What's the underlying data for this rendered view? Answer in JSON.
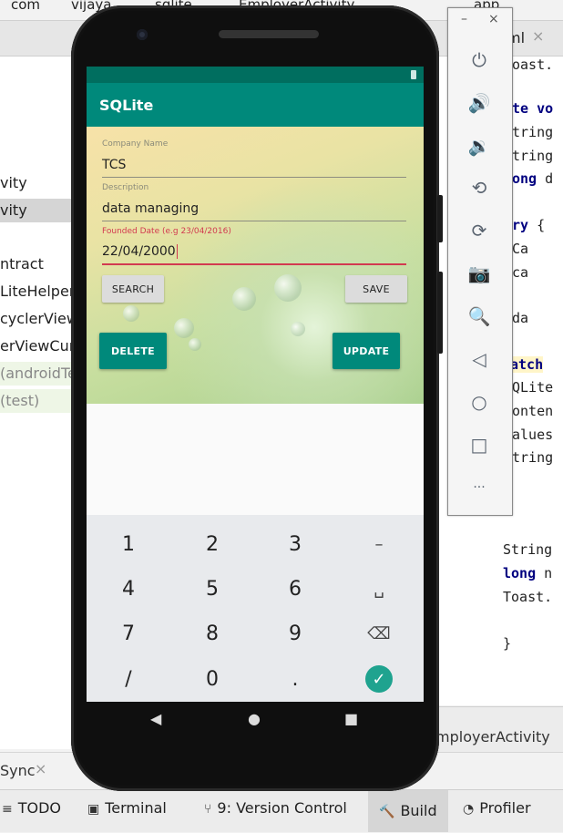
{
  "ide": {
    "breadcrumbs": [
      "com",
      "vijaya",
      "sqlite",
      "EmployerActivity"
    ],
    "run_config": "app",
    "editor_tab": "ml",
    "tree_items": [
      "vity",
      "vity",
      "ntract",
      "LiteHelper",
      "cyclerView",
      "erViewCur",
      "(androidTe",
      "(test)"
    ],
    "code_lines": [
      {
        "pre": "",
        "kw": "",
        "post": "oast."
      },
      {
        "pre": "",
        "kw": "te vo",
        "post": ""
      },
      {
        "pre": "tring",
        "kw": "",
        "post": ""
      },
      {
        "pre": "tring",
        "kw": "",
        "post": ""
      },
      {
        "pre": "",
        "kw": "ong",
        "post": " d"
      },
      {
        "pre": "",
        "kw": "ry",
        "post": " {"
      },
      {
        "pre": "  Ca",
        "kw": "",
        "post": ""
      },
      {
        "pre": "  ca",
        "kw": "",
        "post": ""
      },
      {
        "pre": "  da",
        "kw": "",
        "post": ""
      },
      {
        "pre": "",
        "kw": "atch",
        "post": ""
      },
      {
        "pre": "QLite",
        "kw": "",
        "post": ""
      },
      {
        "pre": "onten",
        "kw": "",
        "post": ""
      },
      {
        "pre": "alues",
        "kw": "",
        "post": ""
      },
      {
        "pre": "tring",
        "kw": "",
        "post": ""
      },
      {
        "pre": "String",
        "kw": "",
        "post": ""
      },
      {
        "pre": "",
        "kw": "long",
        "post": " n"
      },
      {
        "pre": "Toast.",
        "kw": "",
        "post": ""
      },
      {
        "pre": "}",
        "kw": "",
        "post": ""
      }
    ],
    "subtab": "mployerActivity",
    "sync_label": "Sync",
    "bottom_tools": [
      {
        "icon": "≡",
        "label": "TODO"
      },
      {
        "icon": "▣",
        "label": "Terminal"
      },
      {
        "icon": "⑂",
        "label": "9: Version Control"
      },
      {
        "icon": "🔨",
        "label": "Build"
      },
      {
        "icon": "◔",
        "label": "Profiler"
      }
    ]
  },
  "emulator": {
    "minimize": "–",
    "close": "×",
    "buttons": [
      {
        "name": "power-icon",
        "glyph": "⏻"
      },
      {
        "name": "volume-up-icon",
        "glyph": "🔊"
      },
      {
        "name": "volume-down-icon",
        "glyph": "🔉"
      },
      {
        "name": "rotate-left-icon",
        "glyph": "⟲"
      },
      {
        "name": "rotate-right-icon",
        "glyph": "⟳"
      },
      {
        "name": "camera-icon",
        "glyph": "📷"
      },
      {
        "name": "zoom-icon",
        "glyph": "🔍"
      },
      {
        "name": "back-icon",
        "glyph": "◁"
      },
      {
        "name": "home-icon",
        "glyph": "○"
      },
      {
        "name": "overview-icon",
        "glyph": "□"
      },
      {
        "name": "more-icon",
        "glyph": "···"
      }
    ]
  },
  "app": {
    "title": "SQLite",
    "company_label": "Company Name",
    "company_value": "TCS",
    "description_label": "Description",
    "description_value": "data managing",
    "date_label": "Founded Date (e.g 23/04/2016)",
    "date_value": "22/04/2000",
    "search_btn": "SEARCH",
    "save_btn": "SAVE",
    "delete_btn": "DELETE",
    "update_btn": "UPDATE"
  },
  "keyboard": {
    "rows": [
      [
        "1",
        "2",
        "3",
        "–"
      ],
      [
        "4",
        "5",
        "6",
        "␣"
      ],
      [
        "7",
        "8",
        "9",
        "⌫"
      ],
      [
        "/",
        "0",
        ".",
        "✓"
      ]
    ]
  },
  "nav": {
    "back": "◀",
    "home": "●",
    "recents": "■"
  },
  "colors": {
    "primary": "#00897b",
    "primary_dark": "#006e5f",
    "error": "#d23a50"
  }
}
